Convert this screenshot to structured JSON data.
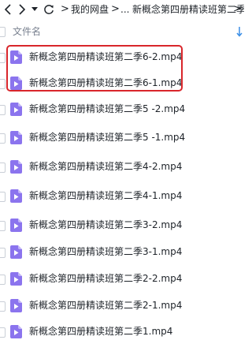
{
  "breadcrumb": {
    "items": [
      "我的网盘",
      "...",
      "新概念第四册精读班第二季"
    ],
    "separator": ">"
  },
  "column_header": {
    "name_label": "文件名"
  },
  "files": [
    {
      "name": "新概念第四册精读班第二季6-2.mp4",
      "highlighted": true
    },
    {
      "name": "新概念第四册精读班第二季6-1.mp4",
      "highlighted": true
    },
    {
      "name": "新概念第四册精读班第二季5 -2.mp4",
      "highlighted": false
    },
    {
      "name": "新概念第四册精读班第二季5 -1.mp4",
      "highlighted": false
    },
    {
      "name": "新概念第四册精读班第二季4-2.mp4",
      "highlighted": false
    },
    {
      "name": "新概念第四册精读班第二季4-1.mp4",
      "highlighted": false
    },
    {
      "name": "新概念第四册精读班第二季3-2.mp4",
      "highlighted": false
    },
    {
      "name": "新概念第四册精读班第二季3-1.mp4",
      "highlighted": false
    },
    {
      "name": "新概念第四册精读班第二季2-2.mp4",
      "highlighted": false
    },
    {
      "name": "新概念第四册精读班第二季2-1.mp4",
      "highlighted": false
    },
    {
      "name": "新概念第四册精读班第二季1.mp4",
      "highlighted": false
    }
  ],
  "icons": {
    "file": "video-file-icon",
    "back": "chevron-left-icon",
    "forward": "chevron-right-icon",
    "history": "caret-down-icon",
    "refresh": "refresh-icon",
    "sort": "sort-arrow-icon"
  },
  "colors": {
    "video_icon": "#8b74ee",
    "highlight_border": "#d9262b",
    "sort_arrow": "#3a8ee6"
  }
}
